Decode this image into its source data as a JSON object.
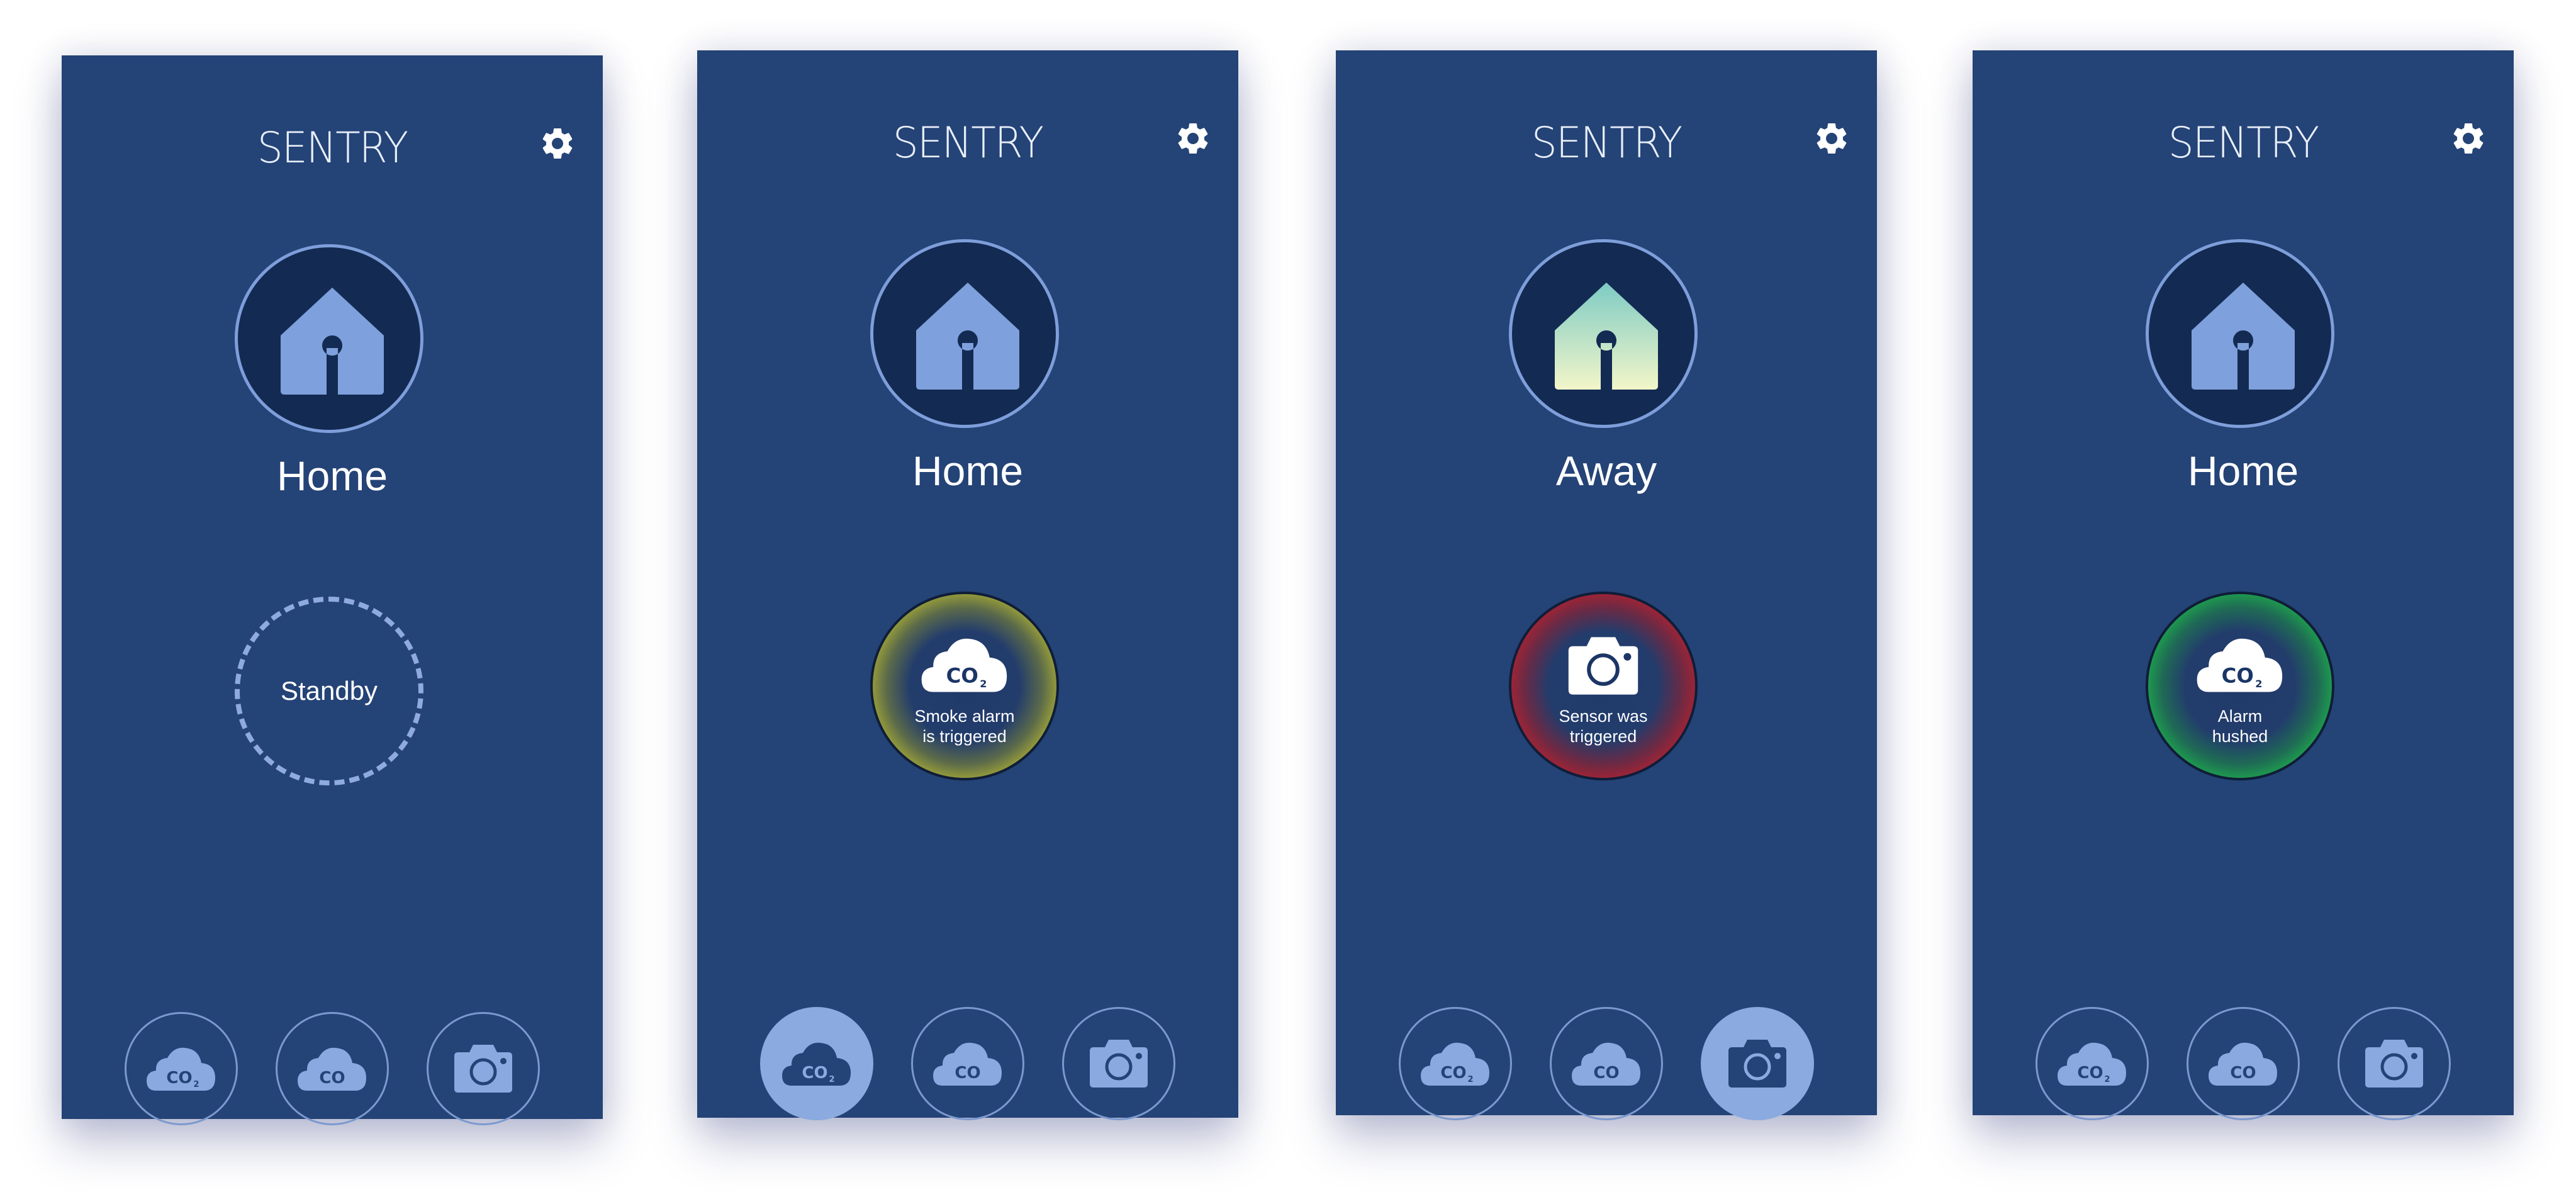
{
  "brand": "SENTRY",
  "screens": [
    {
      "mode": "Home",
      "status": {
        "type": "standby",
        "label": "Standby"
      },
      "tabs": [
        {
          "label": "CO",
          "subscript": "2",
          "icon": "co2-cloud-icon",
          "active": false
        },
        {
          "label": "CO",
          "icon": "co-cloud-icon",
          "active": false
        },
        {
          "icon": "camera-icon",
          "active": false
        }
      ]
    },
    {
      "mode": "Home",
      "status": {
        "type": "alert",
        "color": "#cbc632",
        "icon": "co2-cloud-icon",
        "glyph_label": "CO",
        "glyph_subscript": "2",
        "message_line1": "Smoke alarm",
        "message_line2": "is triggered"
      },
      "tabs": [
        {
          "label": "CO",
          "subscript": "2",
          "icon": "co2-cloud-icon",
          "active": true
        },
        {
          "label": "CO",
          "icon": "co-cloud-icon",
          "active": false
        },
        {
          "icon": "camera-icon",
          "active": false
        }
      ]
    },
    {
      "mode": "Away",
      "status": {
        "type": "alert",
        "color": "#d1232c",
        "icon": "camera-icon",
        "message_line1": "Sensor was",
        "message_line2": "triggered"
      },
      "tabs": [
        {
          "label": "CO",
          "subscript": "2",
          "icon": "co2-cloud-icon",
          "active": false
        },
        {
          "label": "CO",
          "icon": "co-cloud-icon",
          "active": false
        },
        {
          "icon": "camera-icon",
          "active": true
        }
      ]
    },
    {
      "mode": "Home",
      "status": {
        "type": "alert",
        "color": "#22c84d",
        "icon": "co2-cloud-icon",
        "glyph_label": "CO",
        "glyph_subscript": "2",
        "message_line1": "Alarm",
        "message_line2": "hushed"
      },
      "tabs": [
        {
          "label": "CO",
          "subscript": "2",
          "icon": "co2-cloud-icon",
          "active": false
        },
        {
          "label": "CO",
          "icon": "co-cloud-icon",
          "active": false
        },
        {
          "icon": "camera-icon",
          "active": false
        }
      ]
    }
  ],
  "colors": {
    "panel": "#244376",
    "circle_fill": "#132a52",
    "accent": "#8aaae0",
    "house_away_top": "#7ecbc4",
    "house_away_bottom": "#f3f6c9"
  }
}
